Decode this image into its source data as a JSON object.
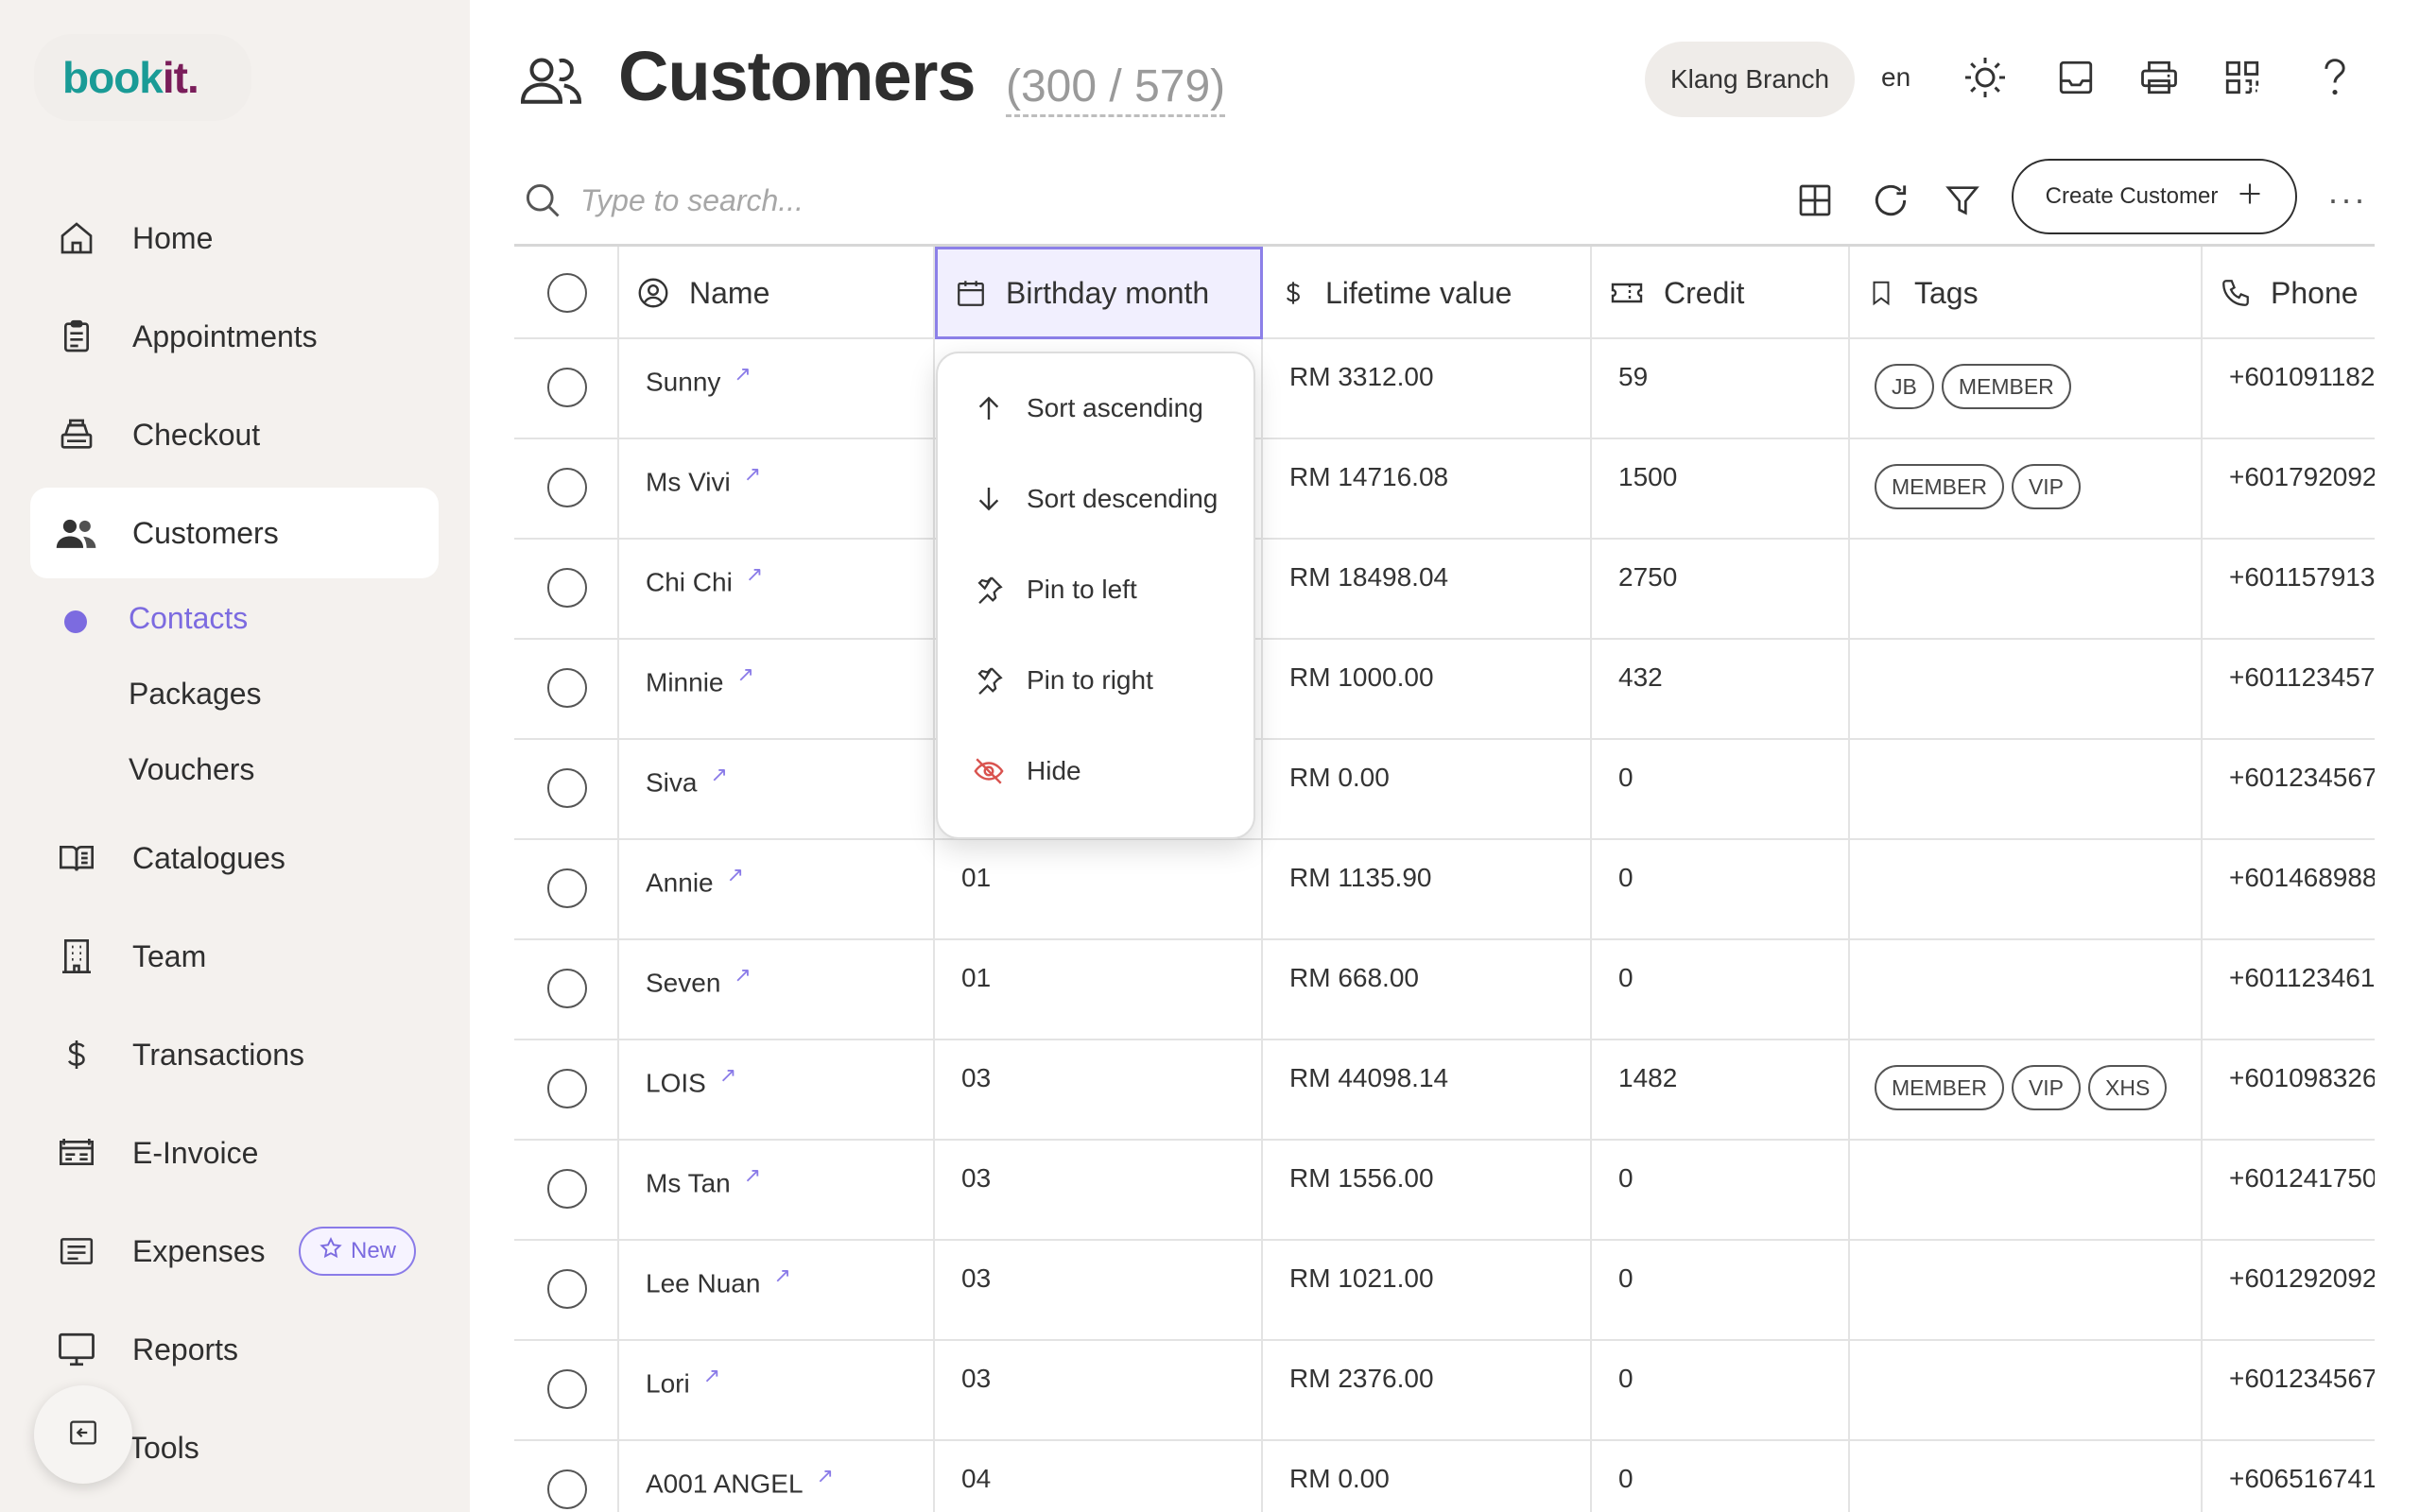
{
  "brand": {
    "logo_part1": "book",
    "logo_part2": "it."
  },
  "sidebar": {
    "items": [
      {
        "label": "Home",
        "icon": "home-icon"
      },
      {
        "label": "Appointments",
        "icon": "clipboard-icon"
      },
      {
        "label": "Checkout",
        "icon": "cash-register-icon"
      },
      {
        "label": "Customers",
        "icon": "users-icon"
      },
      {
        "label": "Catalogues",
        "icon": "book-icon"
      },
      {
        "label": "Team",
        "icon": "building-icon"
      },
      {
        "label": "Transactions",
        "icon": "dollar-icon"
      },
      {
        "label": "E-Invoice",
        "icon": "invoice-icon"
      },
      {
        "label": "Expenses",
        "icon": "receipt-icon"
      },
      {
        "label": "Reports",
        "icon": "presentation-icon"
      },
      {
        "label": "Tools",
        "icon": "tools-icon"
      }
    ],
    "sub_items": [
      {
        "label": "Contacts",
        "active": true
      },
      {
        "label": "Packages"
      },
      {
        "label": "Vouchers"
      }
    ],
    "new_badge": "New"
  },
  "header": {
    "title": "Customers",
    "count": "(300 / 579)",
    "branch": "Klang Branch",
    "language": "en"
  },
  "toolbar": {
    "search_placeholder": "Type to search...",
    "create_label": "Create Customer",
    "more_label": "···"
  },
  "table": {
    "columns": [
      "Name",
      "Birthday month",
      "Lifetime value",
      "Credit",
      "Tags",
      "Phone"
    ],
    "rows": [
      {
        "name": "Sunny",
        "birthday": "",
        "ltv": "RM 3312.00",
        "credit": "59",
        "tags": [
          "JB",
          "MEMBER"
        ],
        "phone": "+601091182"
      },
      {
        "name": "Ms Vivi",
        "birthday": "",
        "ltv": "RM 14716.08",
        "credit": "1500",
        "tags": [
          "MEMBER",
          "VIP"
        ],
        "phone": "+601792092"
      },
      {
        "name": "Chi Chi",
        "birthday": "",
        "ltv": "RM 18498.04",
        "credit": "2750",
        "tags": [],
        "phone": "+601157913"
      },
      {
        "name": "Minnie",
        "birthday": "",
        "ltv": "RM 1000.00",
        "credit": "432",
        "tags": [],
        "phone": "+601123457"
      },
      {
        "name": "Siva",
        "birthday": "",
        "ltv": "RM 0.00",
        "credit": "0",
        "tags": [],
        "phone": "+601234567"
      },
      {
        "name": "Annie",
        "birthday": "01",
        "ltv": "RM 1135.90",
        "credit": "0",
        "tags": [],
        "phone": "+601468988"
      },
      {
        "name": "Seven",
        "birthday": "01",
        "ltv": "RM 668.00",
        "credit": "0",
        "tags": [],
        "phone": "+601123461"
      },
      {
        "name": "LOIS",
        "birthday": "03",
        "ltv": "RM 44098.14",
        "credit": "1482",
        "tags": [
          "MEMBER",
          "VIP",
          "XHS"
        ],
        "phone": "+601098326"
      },
      {
        "name": "Ms Tan",
        "birthday": "03",
        "ltv": "RM 1556.00",
        "credit": "0",
        "tags": [],
        "phone": "+601241750"
      },
      {
        "name": "Lee Nuan",
        "birthday": "03",
        "ltv": "RM 1021.00",
        "credit": "0",
        "tags": [],
        "phone": "+601292092"
      },
      {
        "name": "Lori",
        "birthday": "03",
        "ltv": "RM 2376.00",
        "credit": "0",
        "tags": [],
        "phone": "+601234567"
      },
      {
        "name": "A001 ANGEL",
        "birthday": "04",
        "ltv": "RM 0.00",
        "credit": "0",
        "tags": [],
        "phone": "+606516741"
      }
    ]
  },
  "column_menu": {
    "items": [
      {
        "label": "Sort ascending",
        "icon": "arrow-up-icon"
      },
      {
        "label": "Sort descending",
        "icon": "arrow-down-icon"
      },
      {
        "label": "Pin to left",
        "icon": "pin-icon"
      },
      {
        "label": "Pin to right",
        "icon": "pin-icon"
      },
      {
        "label": "Hide",
        "icon": "eye-off-icon"
      }
    ]
  },
  "colors": {
    "accent": "#7c6be0",
    "hide": "#d9534f",
    "logo_teal": "#1a9b96",
    "logo_plum": "#7a1d5a"
  }
}
